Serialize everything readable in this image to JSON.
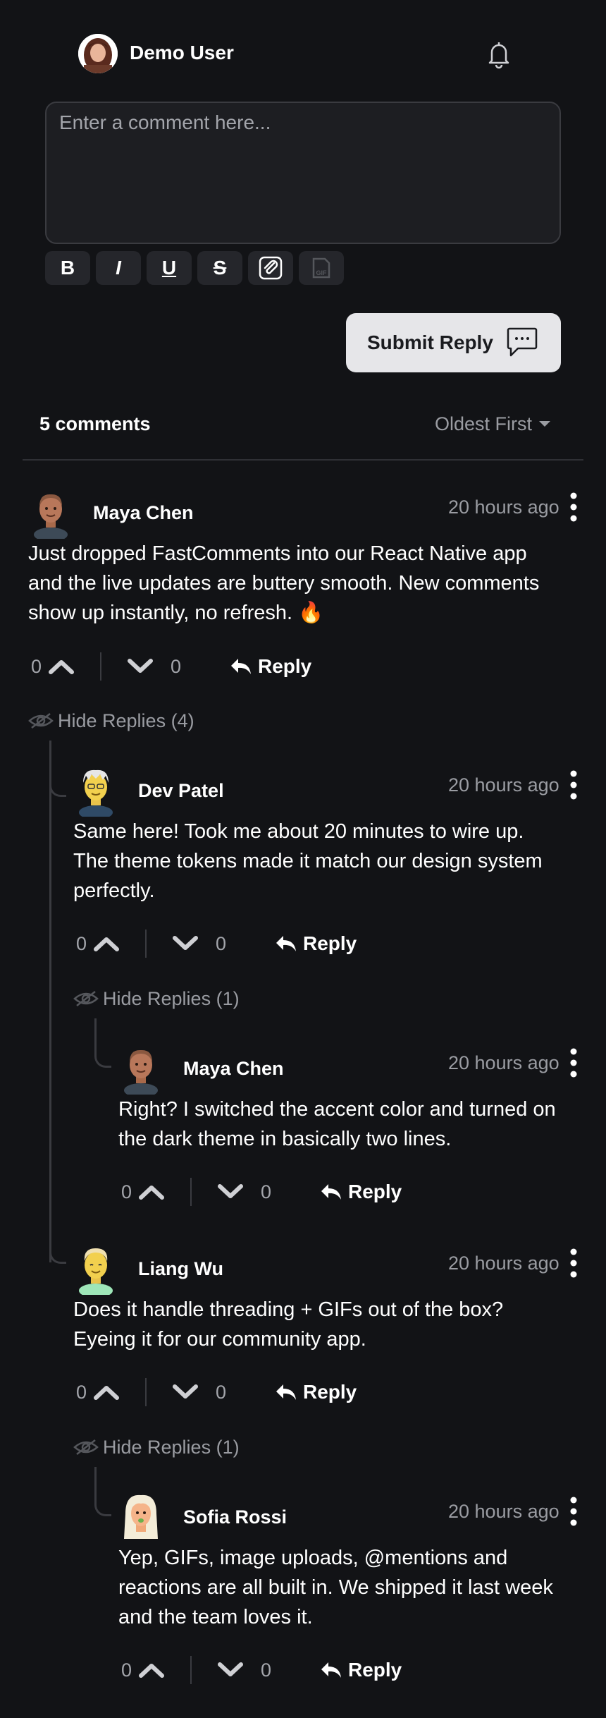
{
  "header": {
    "user_name": "Demo User",
    "avatar_icon": "user-avatar",
    "notification_icon": "bell-icon"
  },
  "composer": {
    "placeholder": "Enter a comment here...",
    "tools": [
      {
        "label": "B",
        "name": "bold"
      },
      {
        "label": "I",
        "name": "italic"
      },
      {
        "label": "U",
        "name": "underline"
      },
      {
        "label": "S",
        "name": "strikethrough"
      },
      {
        "label": "",
        "name": "attach-image",
        "icon": "paperclip-icon"
      },
      {
        "label": "GIF",
        "name": "gif",
        "icon": "gif-icon"
      }
    ],
    "submit_label": "Submit Reply",
    "submit_icon": "chat-bubble-icon"
  },
  "list": {
    "count_label": "5 comments",
    "sort_label": "Oldest First"
  },
  "comments": [
    {
      "id": "c1",
      "author": "Maya Chen",
      "date": "20 hours ago",
      "lines": [
        "Just dropped FastComments into our React Native app",
        "and the live updates are buttery smooth. New comments",
        "show up instantly, no refresh. 🔥"
      ],
      "upvotes": "0",
      "downvotes": "0",
      "reply_label": "Reply",
      "hide_replies_label": "Hide Replies (4)"
    },
    {
      "id": "c2",
      "author": "Dev Patel",
      "date": "20 hours ago",
      "lines": [
        "Same here! Took me about 20 minutes to wire up.",
        "The theme tokens made it match our design system",
        "perfectly."
      ],
      "upvotes": "0",
      "downvotes": "0",
      "reply_label": "Reply",
      "hide_replies_label": "Hide Replies (1)"
    },
    {
      "id": "c3",
      "author": "Maya Chen",
      "date": "20 hours ago",
      "lines": [
        "Right? I switched the accent color and turned on",
        "the dark theme in basically two lines."
      ],
      "upvotes": "0",
      "downvotes": "0",
      "reply_label": "Reply"
    },
    {
      "id": "c4",
      "author": "Liang Wu",
      "date": "20 hours ago",
      "lines": [
        "Does it handle threading + GIFs out of the box?",
        "Eyeing it for our community app."
      ],
      "upvotes": "0",
      "downvotes": "0",
      "reply_label": "Reply",
      "hide_replies_label": "Hide Replies (1)"
    },
    {
      "id": "c5",
      "author": "Sofia Rossi",
      "date": "20 hours ago",
      "lines": [
        "Yep, GIFs, image uploads, @mentions and",
        "reactions are all built in. We shipped it last week",
        "and the team loves it."
      ],
      "upvotes": "0",
      "downvotes": "0",
      "reply_label": "Reply"
    }
  ],
  "colors": {
    "background": "#121316",
    "panel": "#1d1e22",
    "muted_text": "#9a9ca2",
    "submit_bg": "#e6e6e9"
  }
}
